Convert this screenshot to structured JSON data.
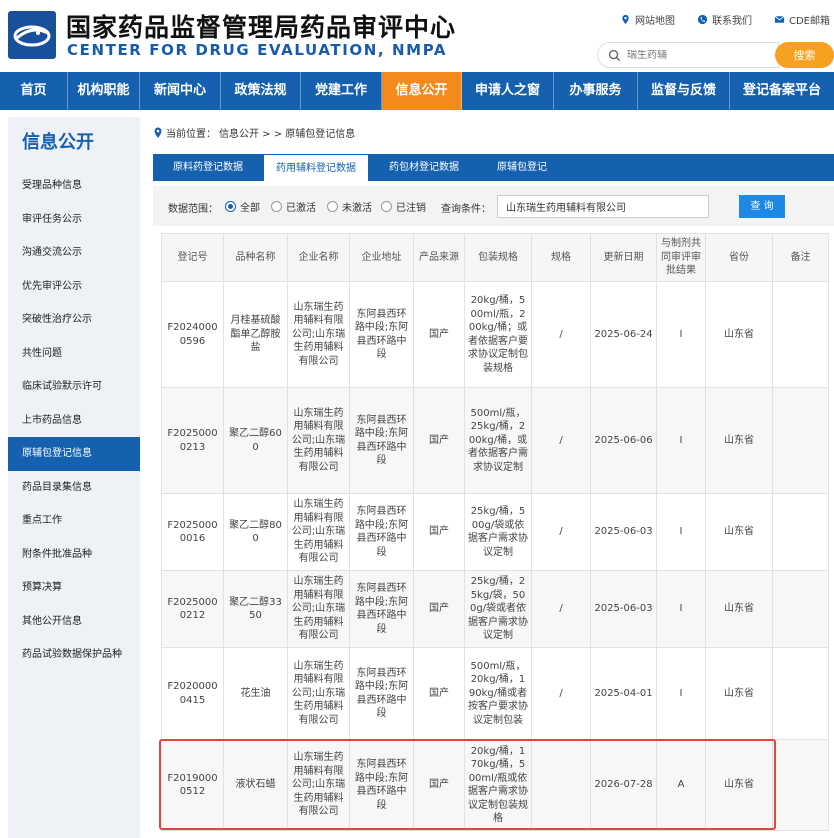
{
  "header": {
    "brand_cn": "国家药品监督管理局药品审评中心",
    "brand_en": "CENTER FOR DRUG EVALUATION, NMPA",
    "top_links": [
      {
        "label": "网站地图",
        "icon": "map-pin-icon"
      },
      {
        "label": "联系我们",
        "icon": "phone-icon"
      },
      {
        "label": "CDE邮箱",
        "icon": "mail-icon"
      }
    ],
    "search_placeholder": "瑞生药辅",
    "search_button": "搜索"
  },
  "nav": {
    "items": [
      "首页",
      "机构职能",
      "新闻中心",
      "政策法规",
      "党建工作",
      "信息公开",
      "申请人之窗",
      "办事服务",
      "监督与反馈",
      "登记备案平台"
    ],
    "active_index": 5
  },
  "sidebar": {
    "title": "信息公开",
    "items": [
      "受理品种信息",
      "审评任务公示",
      "沟通交流公示",
      "优先审评公示",
      "突破性治疗公示",
      "共性问题",
      "临床试验默示许可",
      "上市药品信息",
      "原辅包登记信息",
      "药品目录集信息",
      "重点工作",
      "附条件批准品种",
      "预算决算",
      "其他公开信息",
      "药品试验数据保护品种"
    ],
    "active_index": 8
  },
  "breadcrumb": {
    "prefix": "当前位置：",
    "path": "信息公开 > > 原辅包登记信息"
  },
  "tabs": {
    "items": [
      "原料药登记数据",
      "药用辅料登记数据",
      "药包材登记数据",
      "原辅包登记"
    ],
    "active_index": 1
  },
  "filter": {
    "scope_label": "数据范围：",
    "options": [
      "全部",
      "已激活",
      "未激活",
      "已注销"
    ],
    "selected_index": 0,
    "query_label": "查询条件：",
    "query_value": "山东瑞生药用辅料有限公司",
    "query_button": "查 询"
  },
  "table": {
    "columns": [
      "登记号",
      "品种名称",
      "企业名称",
      "企业地址",
      "产品来源",
      "包装规格",
      "规格",
      "更新日期",
      "与制剂共同审评审批结果",
      "省份",
      "备注"
    ],
    "rows": [
      [
        "F20240000596",
        "月桂基硫酸酯单乙醇胺盐",
        "山东瑞生药用辅料有限公司;山东瑞生药用辅料有限公司",
        "东阿县西环路中段;东阿县西环路中段",
        "国产",
        "20kg/桶，500ml/瓶，200kg/桶；或者依据客户要求协议定制包装规格",
        "/",
        "2025-06-24",
        "I",
        "山东省",
        ""
      ],
      [
        "F20250000213",
        "聚乙二醇600",
        "山东瑞生药用辅料有限公司;山东瑞生药用辅料有限公司",
        "东阿县西环路中段;东阿县西环路中段",
        "国产",
        "500ml/瓶，25kg/桶，200kg/桶，或者依据客户需求协议定制",
        "/",
        "2025-06-06",
        "I",
        "山东省",
        ""
      ],
      [
        "F20250000016",
        "聚乙二醇800",
        "山东瑞生药用辅料有限公司;山东瑞生药用辅料有限公司",
        "东阿县西环路中段;东阿县西环路中段",
        "国产",
        "25kg/桶，500g/袋或依据客户需求协议定制",
        "/",
        "2025-06-03",
        "I",
        "山东省",
        ""
      ],
      [
        "F20250000212",
        "聚乙二醇3350",
        "山东瑞生药用辅料有限公司;山东瑞生药用辅料有限公司",
        "东阿县西环路中段;东阿县西环路中段",
        "国产",
        "25kg/桶，25kg/袋，500g/袋或者依据客户需求协议定制",
        "/",
        "2025-06-03",
        "I",
        "山东省",
        ""
      ],
      [
        "F20200000415",
        "花生油",
        "山东瑞生药用辅料有限公司;山东瑞生药用辅料有限公司",
        "东阿县西环路中段;东阿县西环路中段",
        "国产",
        "500ml/瓶，20kg/桶，190kg/桶或者按客户要求协议定制包装",
        "/",
        "2025-04-01",
        "I",
        "山东省",
        ""
      ],
      [
        "F20190000512",
        "液状石蜡",
        "山东瑞生药用辅料有限公司;山东瑞生药用辅料有限公司",
        "东阿县西环路中段;东阿县西环路中段",
        "国产",
        "20kg/桶，170kg/桶，500ml/瓶或依据客户需求协议定制包装规格",
        "",
        "2026-07-28",
        "A",
        "山东省",
        ""
      ]
    ]
  },
  "colors": {
    "primary": "#1561b0",
    "accent": "#f28b1c",
    "search_button": "#f7a121",
    "highlight": "#e0453e"
  }
}
